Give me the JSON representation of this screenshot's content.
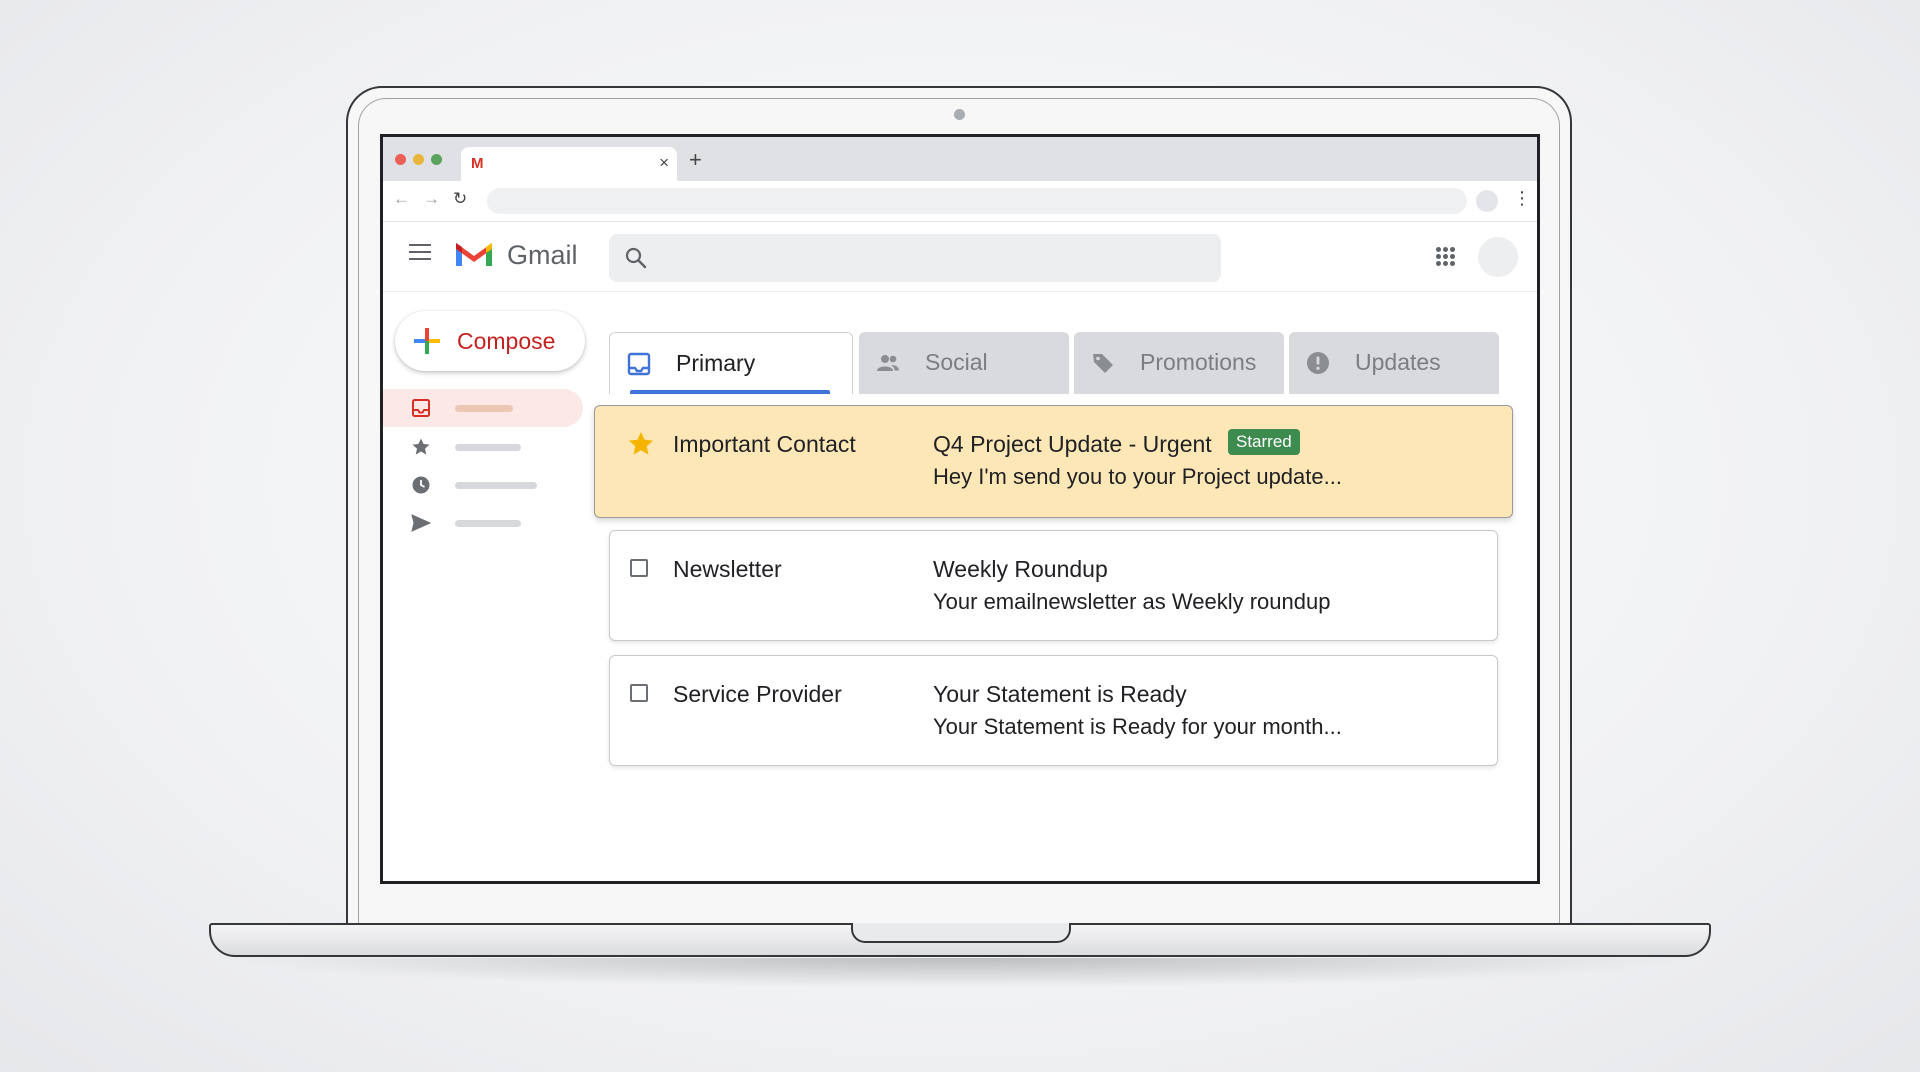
{
  "gmail": {
    "app_name": "Gmail",
    "compose_label": "Compose",
    "tabs": [
      {
        "label": "Primary",
        "active": true,
        "icon": "inbox-icon"
      },
      {
        "label": "Social",
        "active": false,
        "icon": "people-icon"
      },
      {
        "label": "Promotions",
        "active": false,
        "icon": "tag-icon"
      },
      {
        "label": "Updates",
        "active": false,
        "icon": "info-icon"
      }
    ],
    "sidebar_icons": [
      "inbox-icon",
      "star-icon",
      "clock-icon",
      "send-icon"
    ],
    "emails": [
      {
        "sender": "Important Contact",
        "subject": "Q4 Project Update - Urgent",
        "badge": "Starred",
        "snippet": "Hey I'm send you to your Project update...",
        "starred": true
      },
      {
        "sender": "Newsletter",
        "subject": "Weekly Roundup",
        "snippet": "Your emailnewsletter as Weekly roundup",
        "starred": false
      },
      {
        "sender": "Service Provider",
        "subject": "Your Statement is Ready",
        "snippet": "Your Statement is Ready for your month...",
        "starred": false
      }
    ]
  },
  "colors": {
    "starred_row": "#fde7b6",
    "badge_green": "#3d8b4e",
    "compose_red": "#c5221f",
    "primary_underline": "#3f73d8",
    "active_sidebar": "#fce8e6"
  }
}
